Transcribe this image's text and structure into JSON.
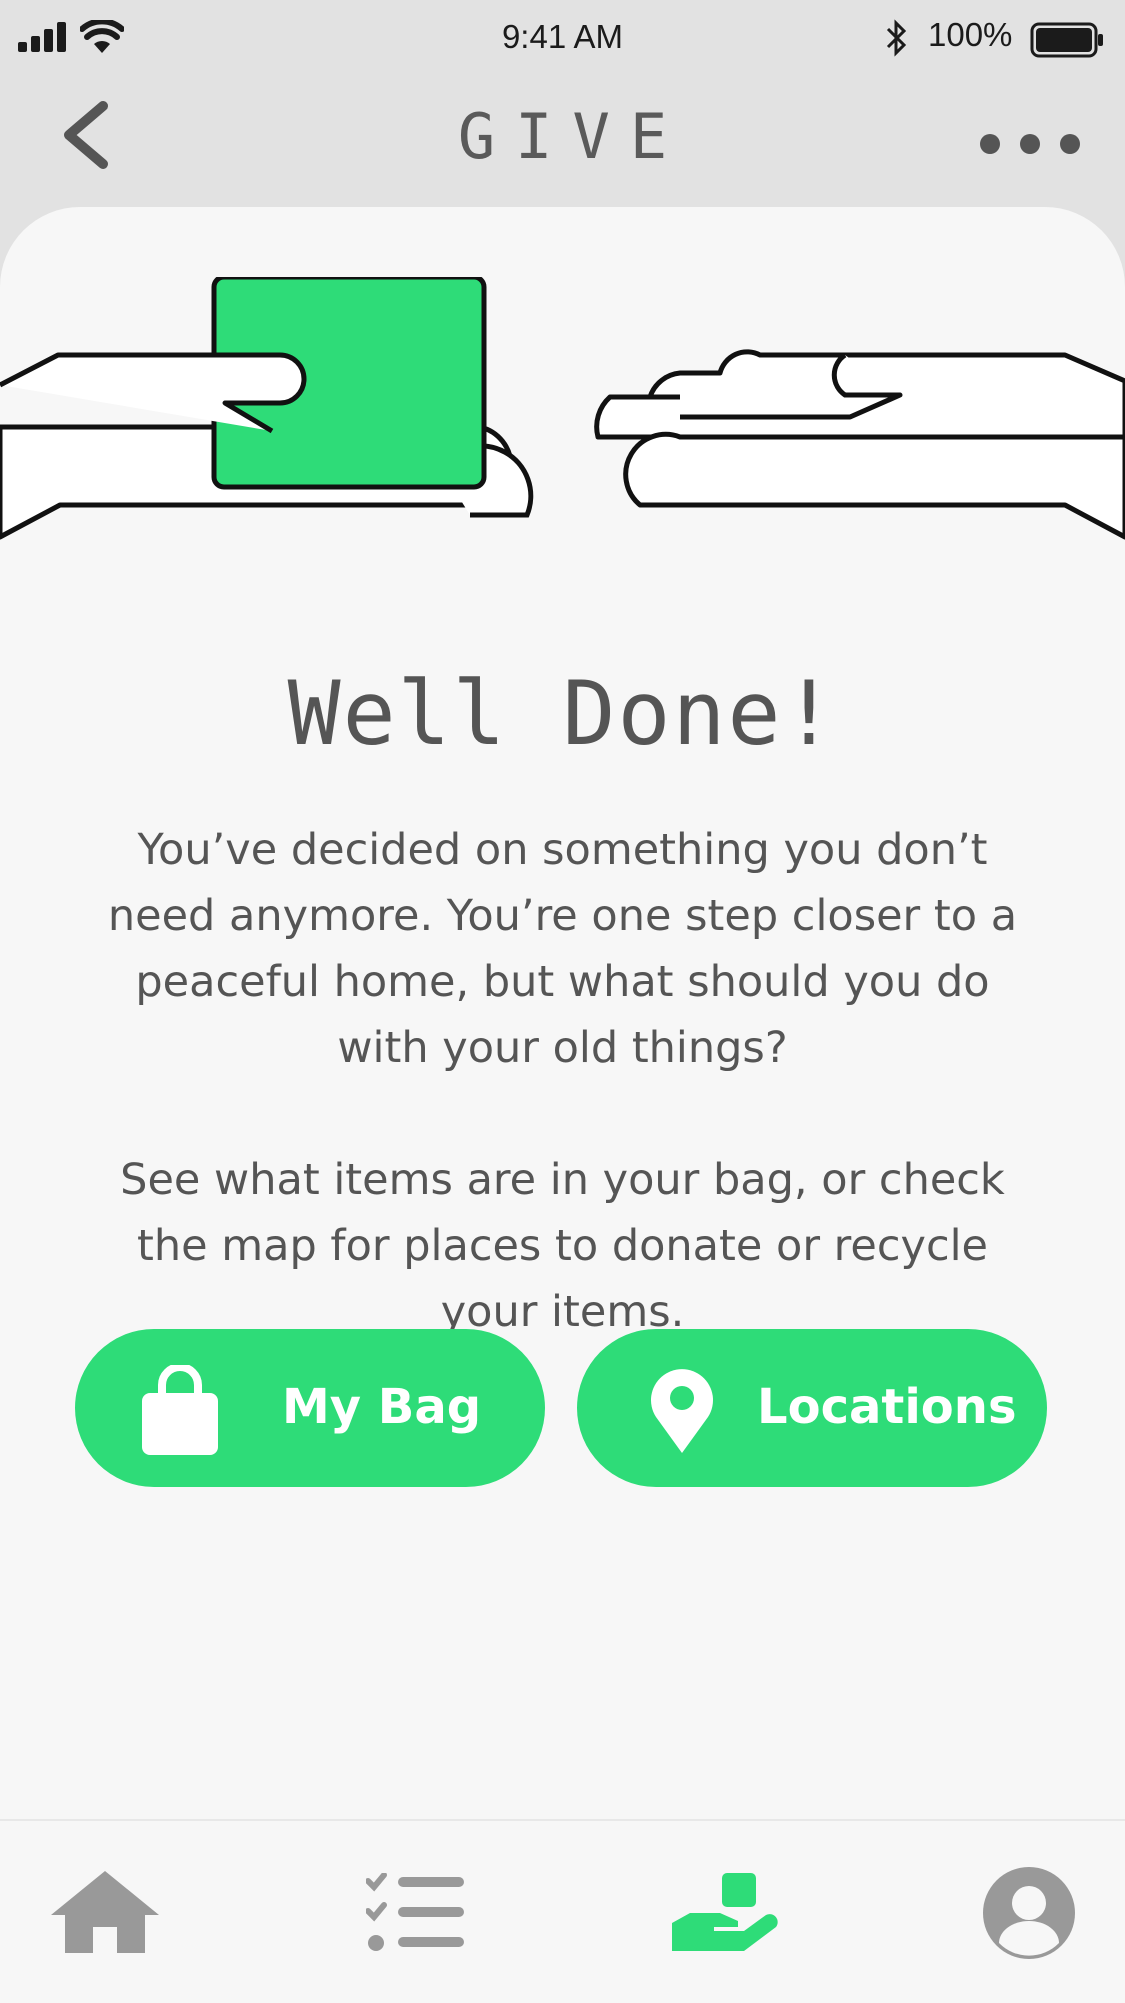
{
  "status_bar": {
    "time": "9:41 AM",
    "battery_percent": "100%"
  },
  "header": {
    "title": "GIVE"
  },
  "main": {
    "headline": "Well Done!",
    "paragraph_1": "You’ve decided on something you don’t need anymore. You’re one step closer to a peaceful home, but what should you do with your old things?",
    "paragraph_2": "See what items are in your bag, or check the map for places to donate or recycle your items."
  },
  "actions": {
    "bag_label": "My Bag",
    "locations_label": "Locations"
  },
  "tab_bar": {
    "items": [
      {
        "icon": "home-icon",
        "active": false
      },
      {
        "icon": "checklist-icon",
        "active": false
      },
      {
        "icon": "give-hand-icon",
        "active": true
      },
      {
        "icon": "profile-icon",
        "active": false
      }
    ]
  },
  "colors": {
    "accent": "#2edc78",
    "header_bg": "#e2e2e2",
    "card_bg": "#f7f7f7",
    "text": "#555555",
    "icon_inactive": "#999999"
  }
}
